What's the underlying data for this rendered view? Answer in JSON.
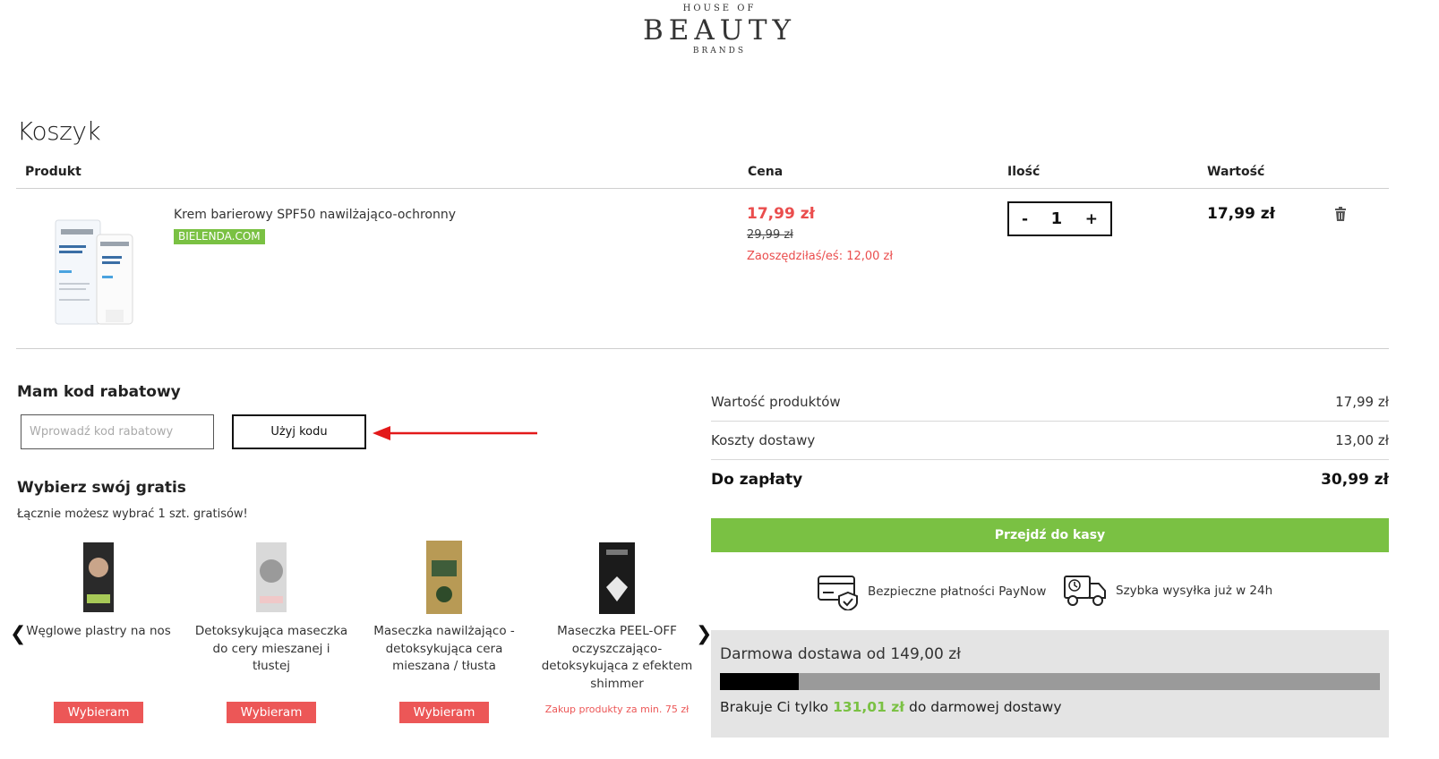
{
  "logo": {
    "line1": "HOUSE OF",
    "line2": "BEAUTY",
    "line3": "BRANDS"
  },
  "page_title": "Koszyk",
  "table_headers": {
    "product": "Produkt",
    "price": "Cena",
    "qty": "Ilość",
    "value": "Wartość"
  },
  "cart_item": {
    "name": "Krem barierowy SPF50 nawilżająco-ochronny",
    "brand": "BIELENDA.COM",
    "image_icon": "product-cream-image",
    "price_new": "17,99 zł",
    "price_old": "29,99 zł",
    "saved": "Zaoszędziłaś/eś: 12,00 zł",
    "qty_minus": "-",
    "qty": "1",
    "qty_plus": "+",
    "line_value": "17,99 zł"
  },
  "discount": {
    "title": "Mam kod rabatowy",
    "placeholder": "Wprowadź kod rabatowy",
    "button": "Użyj kodu"
  },
  "gifts": {
    "title": "Wybierz swój gratis",
    "subtitle": "Łącznie możesz wybrać 1 szt. gratisów!",
    "prev": "❮",
    "next": "❯",
    "items": [
      {
        "name": "Węglowe plastry na nos",
        "button": "Wybieram",
        "thumb_color": "#2a2a2a"
      },
      {
        "name": "Detoksykująca maseczka do cery mieszanej i tłustej",
        "button": "Wybieram",
        "thumb_color": "#b9b9b9"
      },
      {
        "name": "Maseczka nawilżająco - detoksykująca cera mieszana / tłusta",
        "button": "Wybieram",
        "thumb_color": "#b89a55"
      },
      {
        "name": "Maseczka PEEL-OFF oczyszczająco-detoksykująca z efektem shimmer",
        "note": "Zakup produkty za min. 75 zł",
        "thumb_color": "#1b1b1b"
      }
    ]
  },
  "summary": {
    "products_label": "Wartość produktów",
    "products_value": "17,99 zł",
    "shipping_label": "Koszty dostawy",
    "shipping_value": "13,00 zł",
    "total_label": "Do zapłaty",
    "total_value": "30,99 zł",
    "checkout": "Przejdź do kasy"
  },
  "features": {
    "payment": "Bezpieczne płatności PayNow",
    "shipping": "Szybka wysyłka już w 24h"
  },
  "free_shipping": {
    "title": "Darmowa dostawa od 149,00 zł",
    "progress_fraction": 0.12,
    "note_before": "Brakuje Ci tylko",
    "amount": "131,01 zł",
    "note_after": "do darmowej dostawy"
  },
  "colors": {
    "accent_green": "#7ac143",
    "sale_red": "#ea4d4d",
    "gift_button": "#ec5757"
  }
}
